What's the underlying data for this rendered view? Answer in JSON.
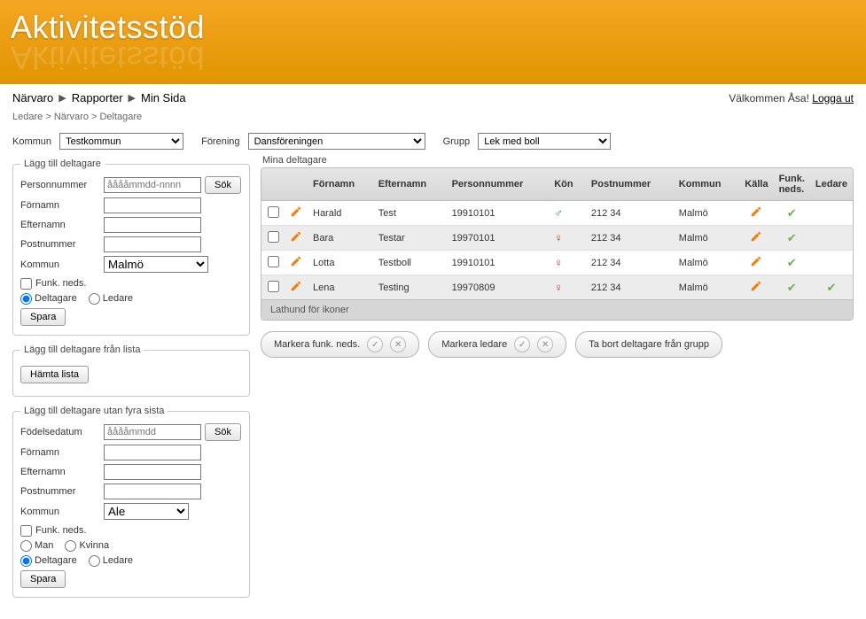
{
  "logo": "Aktivitetsstöd",
  "nav": {
    "narvaro": "Närvaro",
    "rapporter": "Rapporter",
    "minsida": "Min Sida"
  },
  "welcome": {
    "prefix": "Välkommen ",
    "user": "Åsa",
    "suffix": "! ",
    "logout": "Logga ut"
  },
  "breadcrumb": {
    "b1": "Ledare",
    "b2": "Närvaro",
    "b3": "Deltagare",
    "sep": " > "
  },
  "filters": {
    "kommun_label": "Kommun",
    "kommun_value": "Testkommun",
    "forening_label": "Förening",
    "forening_value": "Dansföreningen",
    "grupp_label": "Grupp",
    "grupp_value": "Lek med boll"
  },
  "panel_add": {
    "legend": "Lägg till deltagare",
    "personnummer_label": "Personnummer",
    "personnummer_placeholder": "ååååmmdd-nnnn",
    "sok": "Sök",
    "fornamn_label": "Förnamn",
    "efternamn_label": "Efternamn",
    "postnummer_label": "Postnummer",
    "kommun_label": "Kommun",
    "kommun_value": "Malmö",
    "funk_neds": "Funk. neds.",
    "deltagare": "Deltagare",
    "ledare": "Ledare",
    "spara": "Spara"
  },
  "panel_list": {
    "legend": "Lägg till deltagare från lista",
    "hamta": "Hämta lista"
  },
  "panel_nofour": {
    "legend": "Lägg till deltagare utan fyra sista",
    "fodelsedatum_label": "Födelsedatum",
    "fodelsedatum_placeholder": "ååååmmdd",
    "sok": "Sök",
    "fornamn_label": "Förnamn",
    "efternamn_label": "Efternamn",
    "postnummer_label": "Postnummer",
    "kommun_label": "Kommun",
    "kommun_value": "Ale",
    "funk_neds": "Funk. neds.",
    "man": "Man",
    "kvinna": "Kvinna",
    "deltagare": "Deltagare",
    "ledare": "Ledare",
    "spara": "Spara"
  },
  "table": {
    "legend": "Mina deltagare",
    "headers": {
      "fornamn": "Förnamn",
      "efternamn": "Efternamn",
      "pnr": "Personnummer",
      "kon": "Kön",
      "postnr": "Postnummer",
      "kommun": "Kommun",
      "kalla": "Källa",
      "funk": "Funk. neds.",
      "ledare": "Ledare"
    },
    "rows": [
      {
        "fornamn": "Harald",
        "efternamn": "Test",
        "pnr": "19910101",
        "kon": "M",
        "postnr": "212 34",
        "kommun": "Malmö",
        "ledare": false
      },
      {
        "fornamn": "Bara",
        "efternamn": "Testar",
        "pnr": "19970101",
        "kon": "F",
        "postnr": "212 34",
        "kommun": "Malmö",
        "ledare": false
      },
      {
        "fornamn": "Lotta",
        "efternamn": "Testboll",
        "pnr": "19910101",
        "kon": "F",
        "postnr": "212 34",
        "kommun": "Malmö",
        "ledare": false
      },
      {
        "fornamn": "Lena",
        "efternamn": "Testing",
        "pnr": "19970809",
        "kon": "F",
        "postnr": "212 34",
        "kommun": "Malmö",
        "ledare": true
      }
    ],
    "lathund": "Lathund för ikoner"
  },
  "actions": {
    "markera_funk": "Markera funk. neds.",
    "markera_ledare": "Markera ledare",
    "ta_bort": "Ta bort deltagare från grupp"
  }
}
